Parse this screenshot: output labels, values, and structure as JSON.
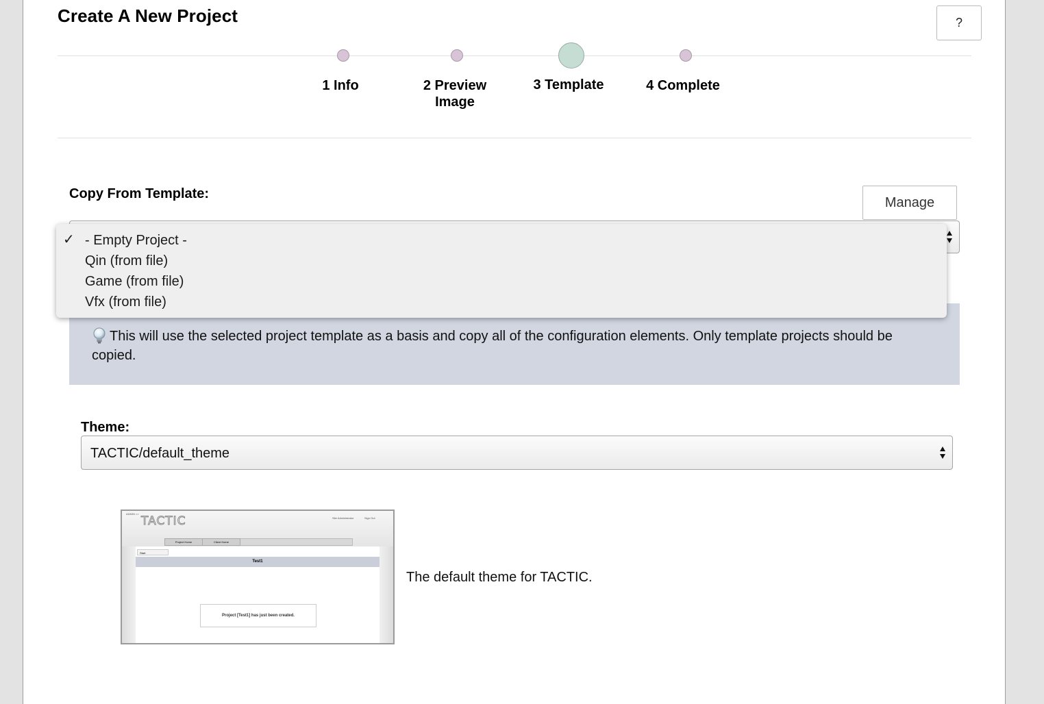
{
  "page": {
    "title": "Create A New Project",
    "help_label": "?"
  },
  "steps": [
    {
      "label": "1 Info",
      "active": false
    },
    {
      "label": "2 Preview Image",
      "active": false
    },
    {
      "label": "3 Template",
      "active": true
    },
    {
      "label": "4 Complete",
      "active": false
    }
  ],
  "template_section": {
    "label": "Copy From Template:",
    "manage_label": "Manage",
    "selected_index": 0,
    "options": [
      "- Empty Project -",
      "Qin (from file)",
      "Game (from file)",
      "Vfx (from file)"
    ],
    "check_mark": "✓",
    "info_text": "This will use the selected project template as a basis and copy all of the configuration elements. Only template projects should be copied."
  },
  "theme_section": {
    "label": "Theme:",
    "selected_value": "TACTIC/default_theme",
    "description": "The default theme for TACTIC.",
    "preview": {
      "admin_text": "ADMIN >>",
      "logo": "TACTIC",
      "header_links": [
        "Site Administrator",
        "Sign Out"
      ],
      "tabs": [
        "Project Home",
        "Client Home"
      ],
      "side_tab": "Start",
      "banner": "Test1",
      "message": "Project [Test1] has just been created."
    }
  },
  "colors": {
    "step_dot": "#d7c4d6",
    "step_dot_active": "#c5ddd3",
    "info_background": "#d1d6e1"
  },
  "icons": {
    "info": "lightbulb-icon",
    "select_arrows": "up-down-arrows-icon"
  }
}
